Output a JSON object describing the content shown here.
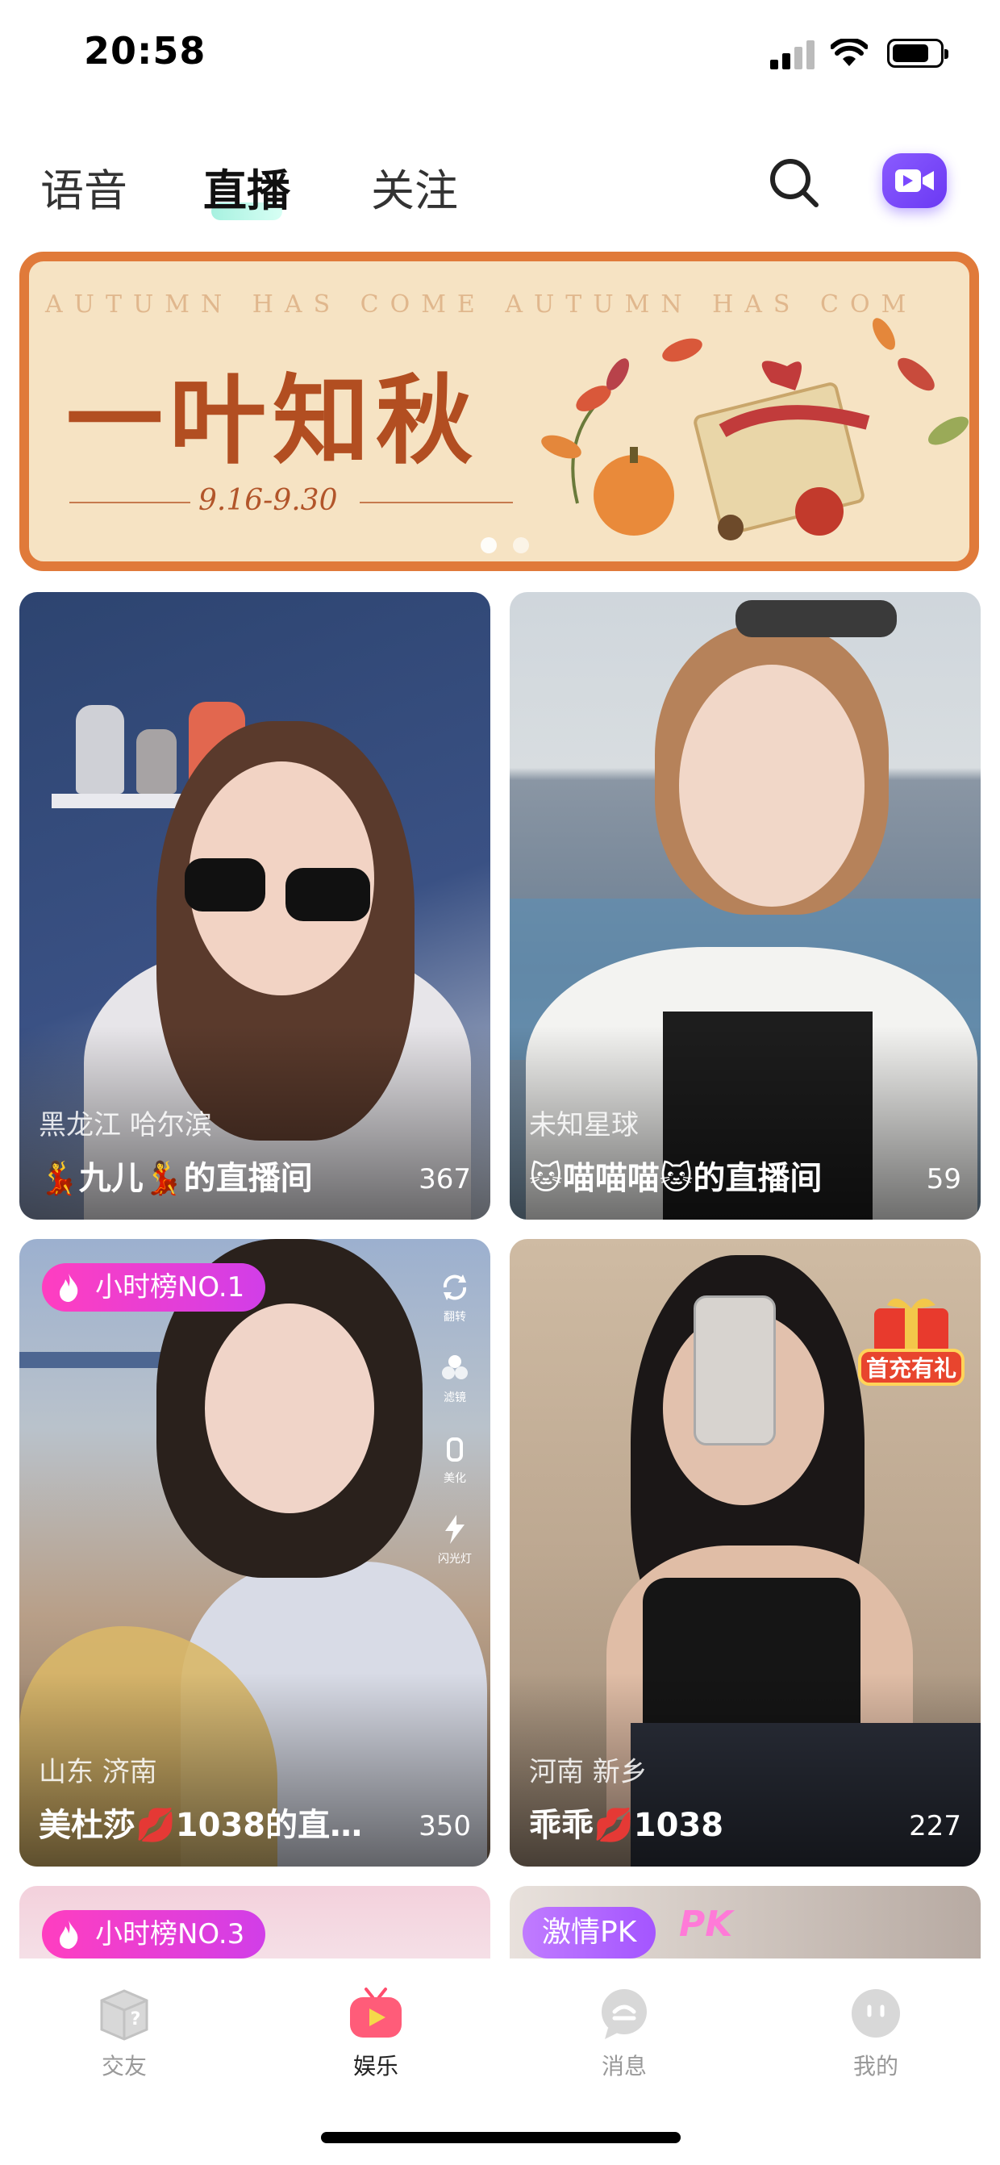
{
  "status_bar": {
    "time": "20:58"
  },
  "top_nav": {
    "tabs": [
      {
        "label": "语音",
        "active": false
      },
      {
        "label": "直播",
        "active": true
      },
      {
        "label": "关注",
        "active": false
      }
    ],
    "search_icon": "search-icon",
    "live_icon": "video-camera-icon"
  },
  "banner": {
    "subtitle": "AUTUMN HAS COME AUTUMN HAS COM",
    "title": "一叶知秋",
    "date": "9.16-9.30",
    "pages": 2,
    "current_page": 1
  },
  "rooms": [
    {
      "location": "黑龙江 哈尔滨",
      "title": "💃九儿💃的直播间",
      "viewers": "367"
    },
    {
      "location": "未知星球",
      "title": "🐱喵喵喵🐱的直播间",
      "viewers": "59"
    },
    {
      "location": "山东 济南",
      "title": "美杜莎💋1038的直…",
      "viewers": "350",
      "badge": "小时榜NO.1"
    },
    {
      "location": "河南 新乡",
      "title": "乖乖💋1038",
      "viewers": "227",
      "promo": "首充有礼"
    },
    {
      "badge": "小时榜NO.3"
    },
    {
      "badge": "激情PK",
      "badge_logo": "PK"
    }
  ],
  "camera_tools": [
    "翻转",
    "滤镜",
    "美化",
    "闪光灯"
  ],
  "bottom_nav": {
    "items": [
      {
        "label": "交友",
        "icon": "box-question-icon",
        "active": false
      },
      {
        "label": "娱乐",
        "icon": "tv-play-icon",
        "active": true
      },
      {
        "label": "消息",
        "icon": "chat-bubble-icon",
        "active": false
      },
      {
        "label": "我的",
        "icon": "face-icon",
        "active": false
      }
    ]
  },
  "colors": {
    "banner_border": "#e07a3a",
    "banner_bg": "#f6e3c3",
    "accent_purple": "#7a48ff",
    "badge_pink": "#ff3ec0",
    "active_nav": "#ff4d6d"
  }
}
